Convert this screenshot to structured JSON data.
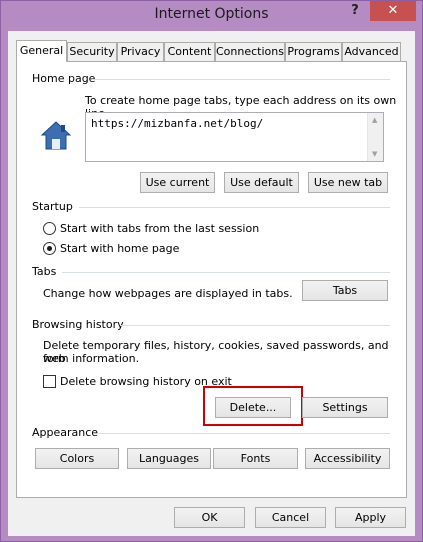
{
  "window": {
    "title": "Internet Options",
    "help_label": "?",
    "close_label": "✕"
  },
  "tabs": [
    "General",
    "Security",
    "Privacy",
    "Content",
    "Connections",
    "Programs",
    "Advanced"
  ],
  "home_page": {
    "heading": "Home page",
    "instruction": "To create home page tabs, type each address on its own line.",
    "address": "https://mizbanfa.net/blog/",
    "use_current": "Use current",
    "use_default": "Use default",
    "use_new_tab": "Use new tab"
  },
  "startup": {
    "heading": "Startup",
    "option_tabs": "Start with tabs from the last session",
    "option_home": "Start with home page",
    "selected": "option_home"
  },
  "tabs_group": {
    "heading": "Tabs",
    "description": "Change how webpages are displayed in tabs.",
    "tabs_button": "Tabs"
  },
  "browsing_history": {
    "heading": "Browsing history",
    "description_line1": "Delete temporary files, history, cookies, saved passwords, and web",
    "description_line2": "form information.",
    "delete_on_exit": "Delete browsing history on exit",
    "delete_on_exit_checked": false,
    "delete_button": "Delete...",
    "settings_button": "Settings"
  },
  "appearance": {
    "heading": "Appearance",
    "colors": "Colors",
    "languages": "Languages",
    "fonts": "Fonts",
    "accessibility": "Accessibility"
  },
  "footer": {
    "ok": "OK",
    "cancel": "Cancel",
    "apply": "Apply"
  },
  "colors": {
    "title_bar": "#b58bc4",
    "close_button": "#c75050",
    "highlight_box": "#d00000"
  }
}
